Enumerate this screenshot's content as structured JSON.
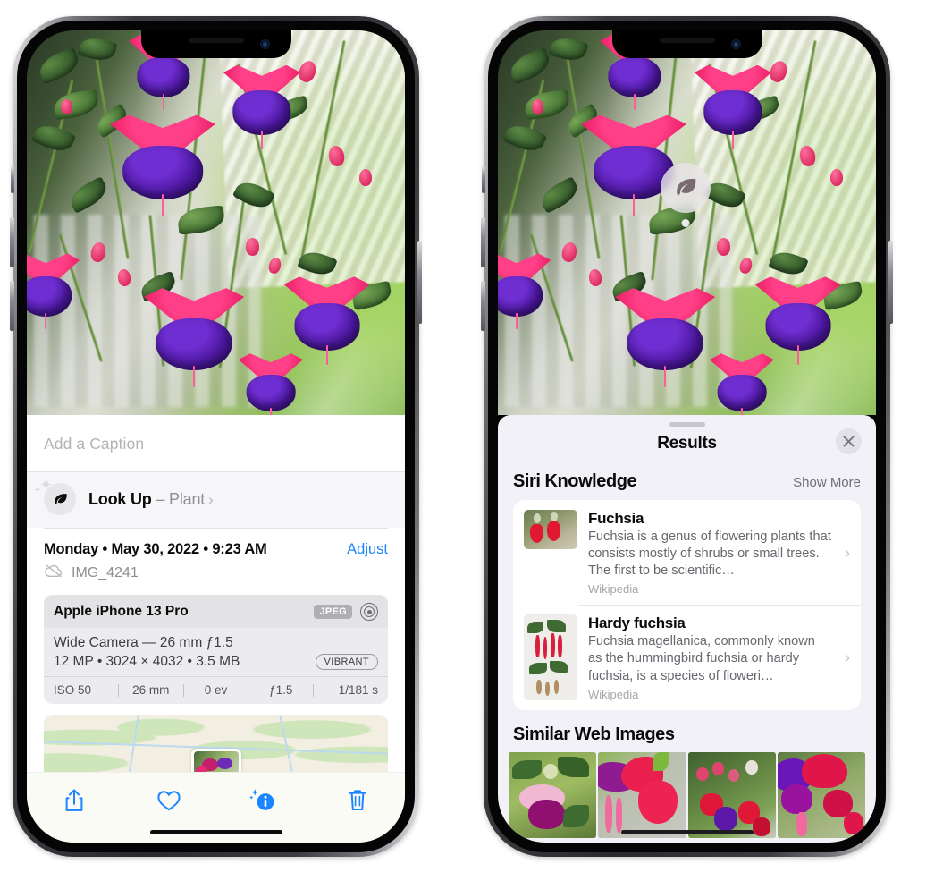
{
  "left_phone": {
    "name": "iphone-photos-info-view",
    "caption_placeholder": "Add a Caption",
    "lookup": {
      "icon": "leaf-icon",
      "label": "Look Up",
      "dash": "–",
      "subject": "Plant",
      "chevron": "›"
    },
    "date_line": "Monday • May 30, 2022 • 9:23 AM",
    "adjust_label": "Adjust",
    "file_icon": "cloud-slash-icon",
    "file_name": "IMG_4241",
    "camera": {
      "model": "Apple iPhone 13 Pro",
      "format_tag": "JPEG",
      "raw_icon": "raw-target-icon",
      "lens_line": "Wide Camera — 26 mm ƒ1.5",
      "spec_line": "12 MP • 3024 × 4032 • 3.5 MB",
      "style_pill": "VIBRANT",
      "exif": [
        "ISO 50",
        "26 mm",
        "0 ev",
        "ƒ1.5",
        "1/181 s"
      ]
    },
    "toolbar": [
      {
        "name": "share-icon",
        "label": "Share"
      },
      {
        "name": "heart-icon",
        "label": "Favorite"
      },
      {
        "name": "info-sparkle-icon",
        "label": "Info"
      },
      {
        "name": "trash-icon",
        "label": "Delete"
      }
    ]
  },
  "right_phone": {
    "name": "iphone-visual-lookup-results",
    "badge_icon": "leaf-icon",
    "sheet": {
      "title": "Results",
      "close_icon": "close-icon",
      "sections": [
        {
          "title": "Siri Knowledge",
          "action": "Show More",
          "items": [
            {
              "title": "Fuchsia",
              "description": "Fuchsia is a genus of flowering plants that consists mostly of shrubs or small trees. The first to be scientific…",
              "source": "Wikipedia",
              "thumb": "fuchsia-red-flowers-thumbnail",
              "chevron": "›"
            },
            {
              "title": "Hardy fuchsia",
              "description": "Fuchsia magellanica, commonly known as the hummingbird fuchsia or hardy fuchsia, is a species of floweri…",
              "source": "Wikipedia",
              "thumb": "hardy-fuchsia-specimen-thumbnail",
              "chevron": "›"
            }
          ]
        },
        {
          "title": "Similar Web Images",
          "tiles": [
            "fuchsia-magenta-bloom-leaves",
            "fuchsia-red-pink-closeup",
            "fuchsia-bush-with-buds",
            "fuchsia-purple-magenta-cluster"
          ]
        }
      ]
    }
  },
  "colors": {
    "accent_blue": "#1a85ff",
    "sheet_background": "#f2f1f7",
    "card_white": "#ffffff",
    "secondary_text": "#8e8e93"
  }
}
